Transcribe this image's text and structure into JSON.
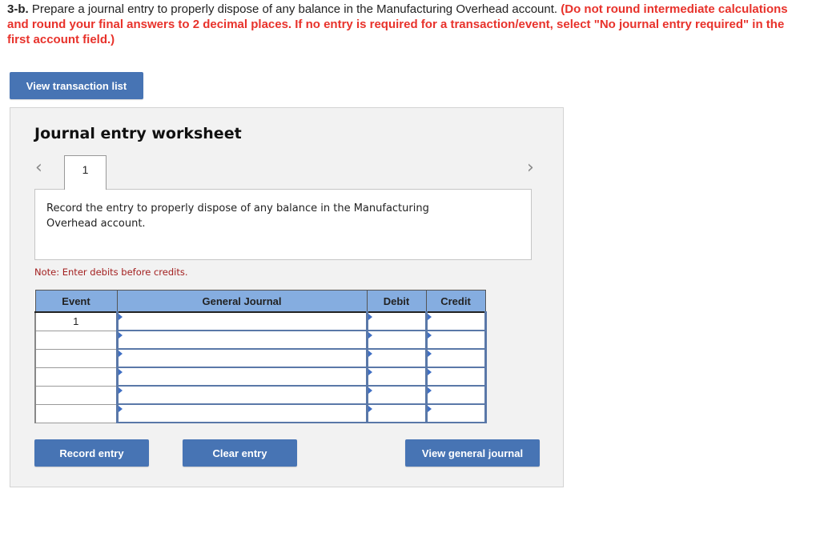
{
  "question": {
    "number": "3-b.",
    "text": " Prepare a journal entry to properly dispose of any balance in the Manufacturing Overhead account. ",
    "instructions": "(Do not round intermediate calculations and round your final answers to 2 decimal places. If no entry is required for a transaction/event, select \"No journal entry required\" in the first account field.)"
  },
  "buttons": {
    "view_transaction_list": "View transaction list",
    "record_entry": "Record entry",
    "clear_entry": "Clear entry",
    "view_general_journal": "View general journal"
  },
  "worksheet": {
    "title": "Journal entry worksheet",
    "nav_prev_icon": "‹",
    "nav_next_icon": "›",
    "active_tab": "1",
    "prompt": "Record the entry to properly dispose of any balance in the Manufacturing Overhead account.",
    "note": "Note: Enter debits before credits."
  },
  "table": {
    "headers": [
      "Event",
      "General Journal",
      "Debit",
      "Credit"
    ],
    "rows": [
      {
        "event": "1",
        "account": "",
        "debit": "",
        "credit": ""
      },
      {
        "event": "",
        "account": "",
        "debit": "",
        "credit": ""
      },
      {
        "event": "",
        "account": "",
        "debit": "",
        "credit": ""
      },
      {
        "event": "",
        "account": "",
        "debit": "",
        "credit": ""
      },
      {
        "event": "",
        "account": "",
        "debit": "",
        "credit": ""
      },
      {
        "event": "",
        "account": "",
        "debit": "",
        "credit": ""
      }
    ]
  },
  "colors": {
    "accent_button": "#4774b4",
    "instruction_red": "#e8322b",
    "note_red": "#a32020",
    "table_header": "#85ade0"
  }
}
